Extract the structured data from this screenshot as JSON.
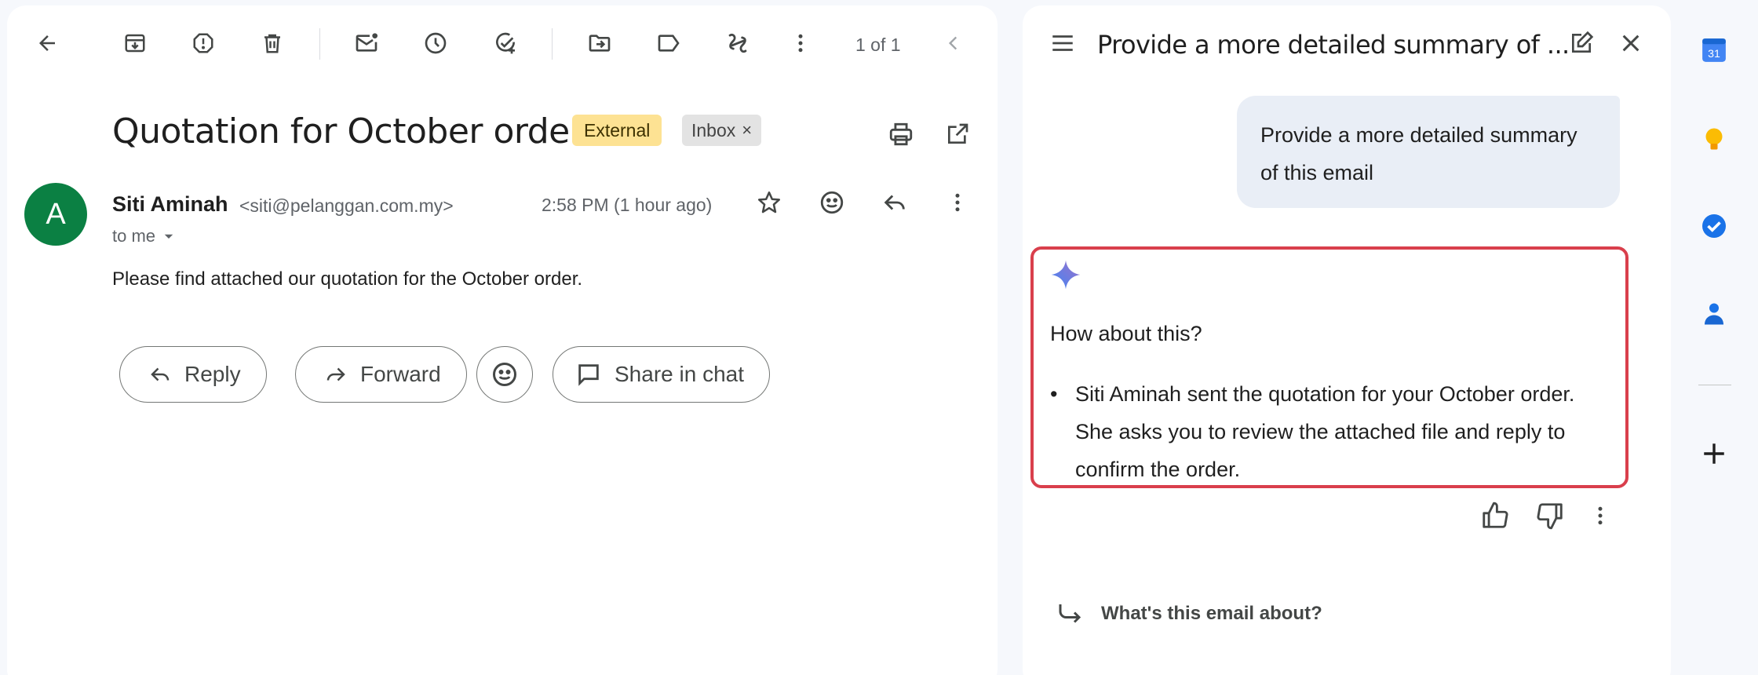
{
  "toolbar": {
    "pagination": "1 of 1"
  },
  "email": {
    "subject": "Quotation for October order",
    "badges": {
      "external": "External",
      "inbox": "Inbox",
      "inbox_close": "×"
    },
    "sender": {
      "initial": "A",
      "name": "Siti Aminah",
      "email": "<siti@pelanggan.com.my>",
      "avatar_color": "#0b8043"
    },
    "recipient": "to me",
    "timestamp": "2:58 PM (1 hour ago)",
    "body": "Please find attached our quotation for the October order.",
    "actions": {
      "reply": "Reply",
      "forward": "Forward",
      "share": "Share in chat"
    }
  },
  "gemini": {
    "title": "Provide a more detailed summary of ...",
    "user_prompt": "Provide a more detailed summary of this email",
    "response": {
      "intro": "How about this?",
      "bullet": "Siti Aminah sent the quotation for your October order. She asks you to review the attached file and reply to confirm the order."
    },
    "suggestion": "What's this email about?",
    "highlight_color": "#d93f4c"
  },
  "rail": {
    "calendar_day": "31"
  }
}
